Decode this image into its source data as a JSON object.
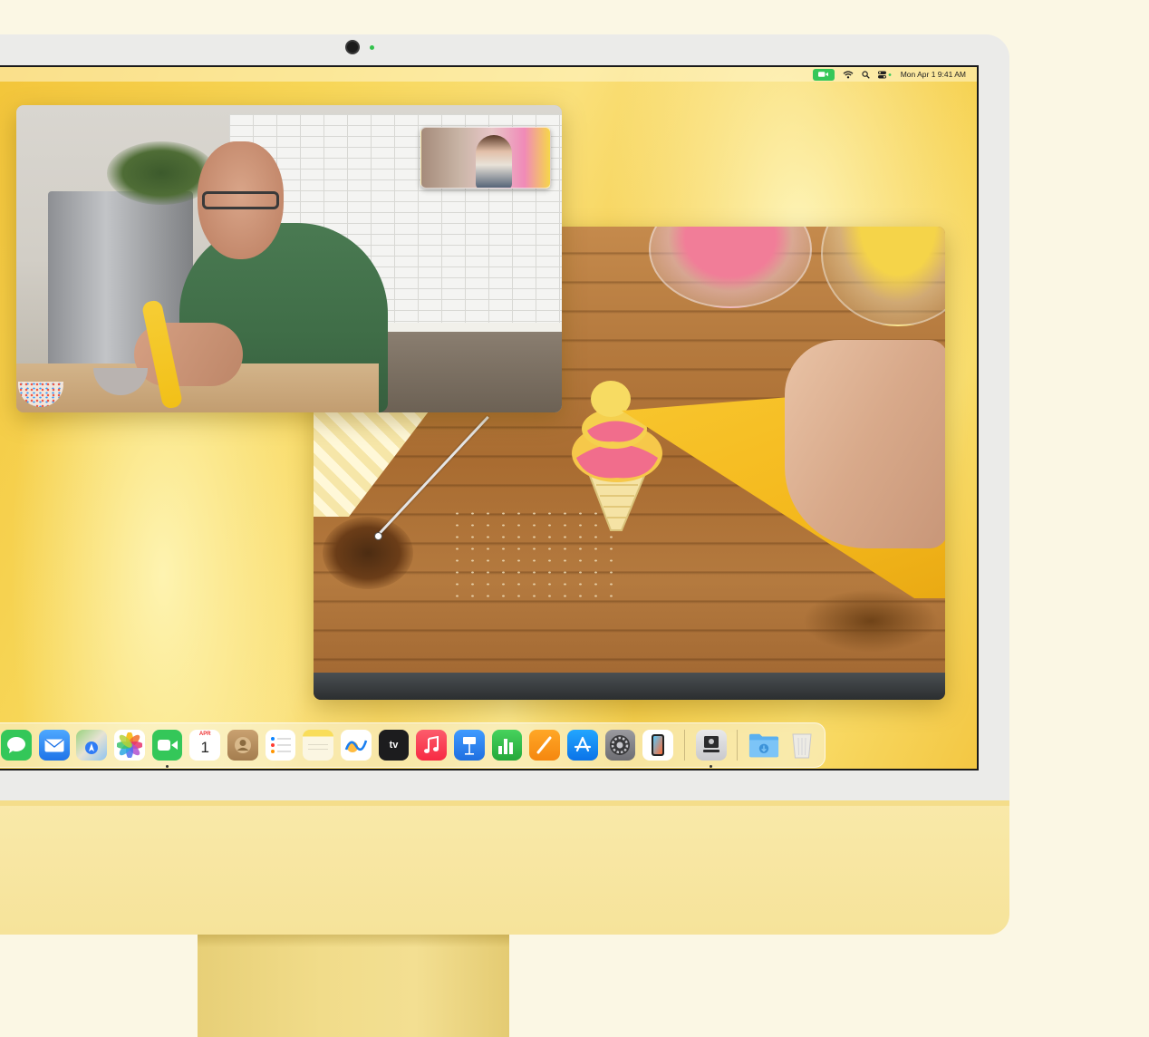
{
  "menubar": {
    "status_icons": [
      "facetime-video-icon",
      "wifi-icon",
      "search-icon",
      "control-center-icon"
    ],
    "clock": "Mon Apr 1  9:41 AM"
  },
  "facetime": {
    "caller_video": "caller-video",
    "self_view": "self-view-video"
  },
  "shared_screen": {
    "content": "cookie-decorating-video"
  },
  "dock": {
    "apps": [
      {
        "name": "Messages",
        "icon": "messages-icon",
        "color": "#34c759",
        "running": false
      },
      {
        "name": "Mail",
        "icon": "mail-icon",
        "color": "#2f8cf3",
        "running": false
      },
      {
        "name": "Maps",
        "icon": "maps-icon",
        "color": "#6fbf5a",
        "running": false
      },
      {
        "name": "Photos",
        "icon": "photos-icon",
        "color": "#ffffff",
        "running": false
      },
      {
        "name": "FaceTime",
        "icon": "facetime-icon",
        "color": "#34c759",
        "running": true
      },
      {
        "name": "Calendar",
        "icon": "calendar-icon",
        "color": "#ffffff",
        "running": false
      },
      {
        "name": "Contacts",
        "icon": "contacts-icon",
        "color": "#b08a5a",
        "running": false
      },
      {
        "name": "Reminders",
        "icon": "reminders-icon",
        "color": "#ffffff",
        "running": false
      },
      {
        "name": "Notes",
        "icon": "notes-icon",
        "color": "#fbf6e2",
        "running": false
      },
      {
        "name": "Freeform",
        "icon": "freeform-icon",
        "color": "#ffffff",
        "running": false
      },
      {
        "name": "TV",
        "icon": "tv-icon",
        "color": "#1c1c1e",
        "running": false
      },
      {
        "name": "Music",
        "icon": "music-icon",
        "color": "#fa3b4f",
        "running": false
      },
      {
        "name": "Keynote",
        "icon": "keynote-icon",
        "color": "#2b8cf0",
        "running": false
      },
      {
        "name": "Numbers",
        "icon": "numbers-icon",
        "color": "#2fbf4a",
        "running": false
      },
      {
        "name": "Pages",
        "icon": "pages-icon",
        "color": "#f7941d",
        "running": false
      },
      {
        "name": "App Store",
        "icon": "app-store-icon",
        "color": "#1a8cff",
        "running": false
      },
      {
        "name": "System Settings",
        "icon": "system-settings-icon",
        "color": "#8e8e93",
        "running": false
      },
      {
        "name": "iPhone Mirroring",
        "icon": "iphone-mirroring-icon",
        "color": "#ffffff",
        "running": false
      }
    ],
    "calendar": {
      "month": "APR",
      "day": "1"
    },
    "tv_label": "tv",
    "recent": {
      "name": "Screen Sharing",
      "icon": "screen-sharing-icon",
      "running": true
    },
    "folders": [
      {
        "name": "Downloads",
        "icon": "downloads-folder-icon"
      },
      {
        "name": "Trash",
        "icon": "trash-icon"
      }
    ]
  }
}
